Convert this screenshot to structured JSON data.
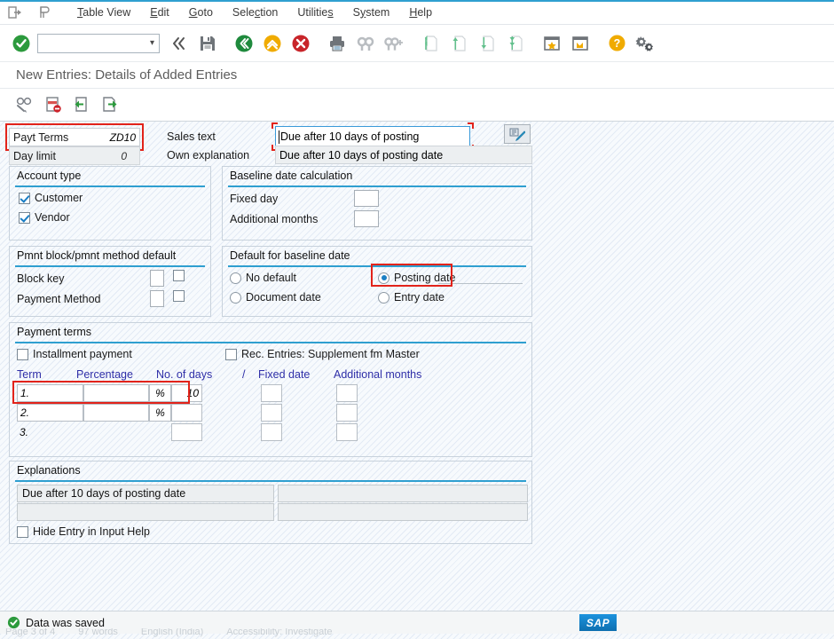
{
  "menubar": {
    "icons": [
      {
        "name": "exit-icon",
        "glyph": "exit"
      },
      {
        "name": "pin-icon",
        "glyph": "pin"
      }
    ],
    "items": [
      {
        "label": "Table View",
        "accel": "T"
      },
      {
        "label": "Edit",
        "accel": "E"
      },
      {
        "label": "Goto",
        "accel": "G"
      },
      {
        "label": "Selection",
        "accel": "c"
      },
      {
        "label": "Utilities",
        "accel": "s"
      },
      {
        "label": "System",
        "accel": "y"
      },
      {
        "label": "Help",
        "accel": "H"
      }
    ]
  },
  "toolbar": {
    "command_value": "",
    "command_placeholder": "",
    "buttons": [
      {
        "name": "enter-button",
        "tip": "Enter"
      },
      {
        "name": "back-collapse-button",
        "tip": "Back"
      },
      {
        "name": "save-button",
        "tip": "Save"
      },
      {
        "name": "back-button",
        "tip": "Back"
      },
      {
        "name": "exit-button",
        "tip": "Exit"
      },
      {
        "name": "cancel-button",
        "tip": "Cancel"
      },
      {
        "name": "print-button",
        "tip": "Print"
      },
      {
        "name": "find-button",
        "tip": "Find"
      },
      {
        "name": "find-next-button",
        "tip": "Find Next"
      },
      {
        "name": "first-page-button",
        "tip": "First Page"
      },
      {
        "name": "previous-page-button",
        "tip": "Previous Page"
      },
      {
        "name": "next-page-button",
        "tip": "Next Page"
      },
      {
        "name": "last-page-button",
        "tip": "Last Page"
      },
      {
        "name": "create-favorite-button",
        "tip": "Create Favorite"
      },
      {
        "name": "new-session-button",
        "tip": "Create New Session"
      },
      {
        "name": "help-button",
        "tip": "Help"
      },
      {
        "name": "customize-button",
        "tip": "Customize Local Layout"
      }
    ]
  },
  "title": "New Entries: Details of Added Entries",
  "apptoolbar": {
    "buttons": [
      {
        "name": "display-change-button",
        "tip": "Display/Change"
      },
      {
        "name": "delete-entry-button",
        "tip": "Delete Entry"
      },
      {
        "name": "previous-entry-button",
        "tip": "Previous Entry"
      },
      {
        "name": "next-entry-button",
        "tip": "Next Entry"
      }
    ]
  },
  "header_fields": {
    "payt_terms_label": "Payt Terms",
    "payt_terms_value": "ZD10",
    "day_limit_label": "Day limit",
    "day_limit_value": "0",
    "sales_text_label": "Sales text",
    "sales_text_value": "Due after 10 days of posting",
    "own_explanation_label": "Own explanation",
    "own_explanation_value": "Due after 10 days of posting date",
    "translate_button_name": "translate-button"
  },
  "account_type": {
    "title": "Account type",
    "options": [
      {
        "label": "Customer",
        "checked": true
      },
      {
        "label": "Vendor",
        "checked": true
      }
    ]
  },
  "baseline_date_calculation": {
    "title": "Baseline date calculation",
    "fields": [
      {
        "label": "Fixed day",
        "value": ""
      },
      {
        "label": "Additional months",
        "value": ""
      }
    ]
  },
  "pmnt_block": {
    "title": "Pmnt block/pmnt method default",
    "fields": [
      {
        "label": "Block key",
        "value": "",
        "checkbox": false
      },
      {
        "label": "Payment Method",
        "value": "",
        "checkbox": false
      }
    ]
  },
  "default_baseline": {
    "title": "Default for baseline date",
    "options": [
      {
        "label": "No default",
        "selected": false
      },
      {
        "label": "Posting date",
        "selected": true,
        "highlighted": true
      },
      {
        "label": "Document date",
        "selected": false
      },
      {
        "label": "Entry date",
        "selected": false
      }
    ]
  },
  "payment_terms": {
    "title": "Payment terms",
    "installment_payment": {
      "label": "Installment payment",
      "checked": false
    },
    "rec_entries": {
      "label": "Rec. Entries: Supplement fm Master",
      "checked": false
    },
    "left_headers": [
      "Term",
      "Percentage",
      "No. of days"
    ],
    "right_headers": [
      "/",
      "Fixed date",
      "Additional months"
    ],
    "rows": [
      {
        "term": "1.",
        "percentage": "",
        "percent_sign": "%",
        "days": "10",
        "fixed_date": "",
        "additional_months": "",
        "highlighted": true
      },
      {
        "term": "2.",
        "percentage": "",
        "percent_sign": "%",
        "days": "",
        "fixed_date": "",
        "additional_months": "",
        "highlighted": false
      },
      {
        "term": "3.",
        "percentage": null,
        "percent_sign": "",
        "days": "",
        "fixed_date": "",
        "additional_months": "",
        "highlighted": false
      }
    ]
  },
  "explanations": {
    "title": "Explanations",
    "rows": [
      {
        "left": "Due after 10 days of posting date",
        "right": ""
      },
      {
        "left": "",
        "right": ""
      }
    ],
    "hide_entry": {
      "label": "Hide Entry in Input Help",
      "checked": false
    }
  },
  "statusbar": {
    "message": "Data was saved",
    "logo": "SAP"
  },
  "background_strip": {
    "items": [
      "Page 3 of 4",
      "97 words",
      "English (India)",
      "Accessibility: Investigate"
    ]
  },
  "colors": {
    "accent": "#2f9fd0",
    "annotation_red": "#e2231a",
    "header_link_blue": "#2f2fa8",
    "sap_blue": "#1a8ad4",
    "success_green": "#2c9a3d"
  }
}
